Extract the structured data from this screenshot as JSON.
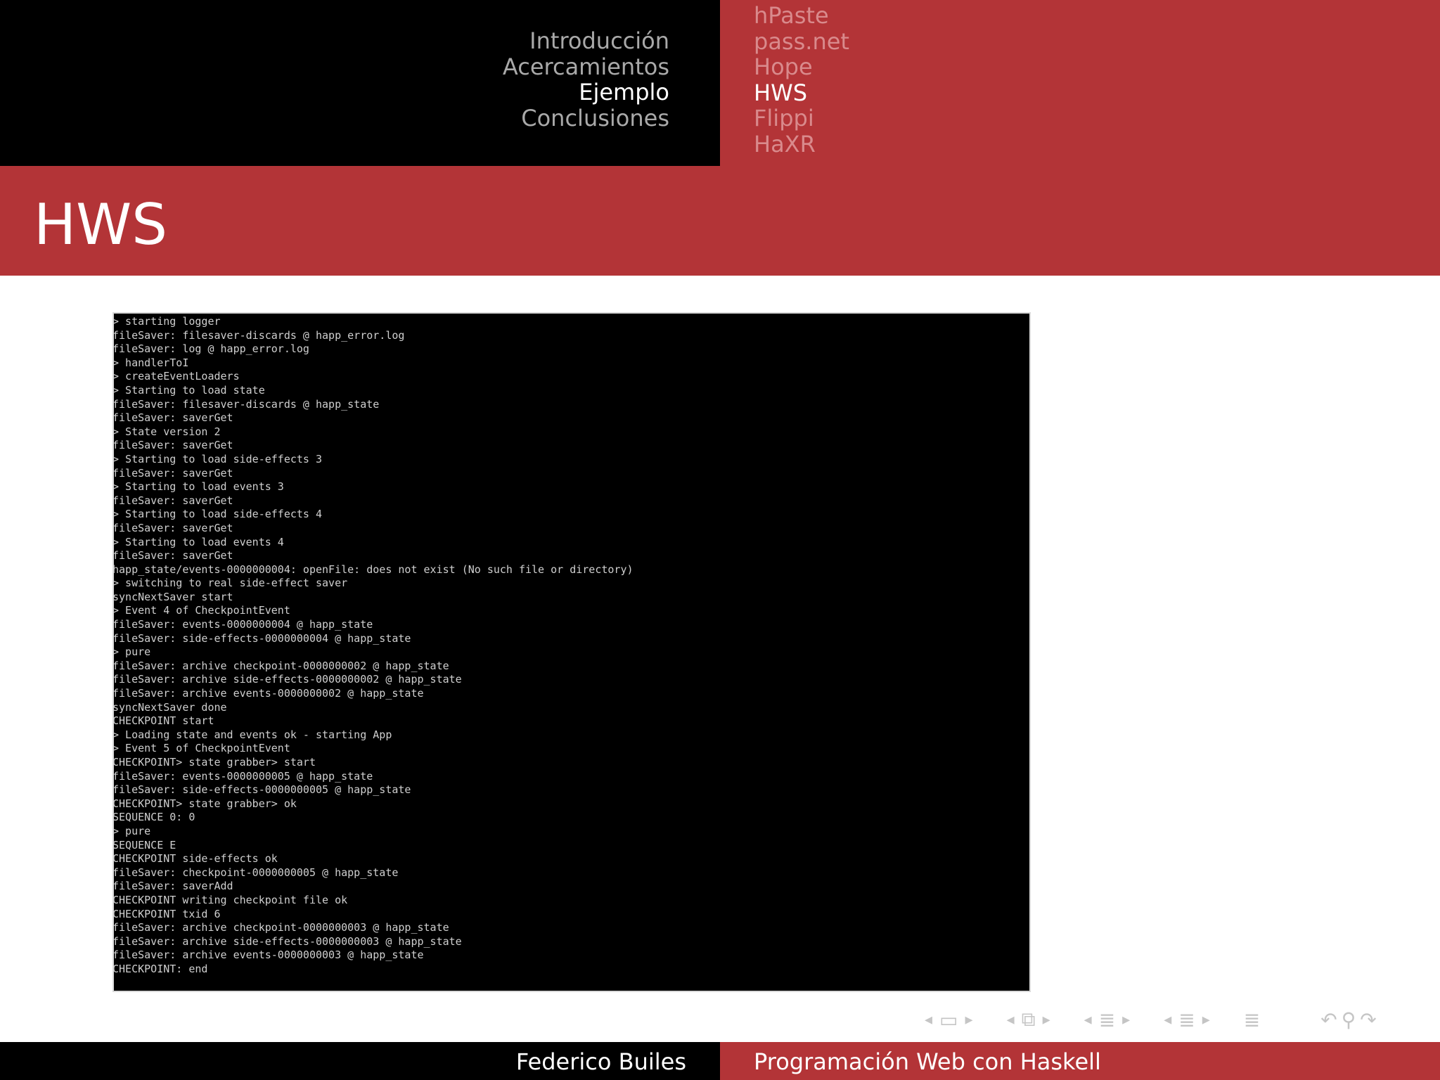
{
  "header": {
    "sections": [
      "Introducción",
      "Acercamientos",
      "Ejemplo",
      "Conclusiones"
    ],
    "subsections": [
      "hPaste",
      "pass.net",
      "Hope",
      "HWS",
      "Flippi",
      "HaXR"
    ]
  },
  "frame_title": "HWS",
  "terminal_lines": [
    "> starting logger",
    "fileSaver: filesaver-discards @ happ_error.log",
    "fileSaver: log @ happ_error.log",
    "> handlerToI",
    "> createEventLoaders",
    "> Starting to load state",
    "fileSaver: filesaver-discards @ happ_state",
    "fileSaver: saverGet",
    "> State version 2",
    "fileSaver: saverGet",
    "> Starting to load side-effects 3",
    "fileSaver: saverGet",
    "> Starting to load events 3",
    "fileSaver: saverGet",
    "> Starting to load side-effects 4",
    "fileSaver: saverGet",
    "> Starting to load events 4",
    "fileSaver: saverGet",
    "happ_state/events-0000000004: openFile: does not exist (No such file or directory)",
    "> switching to real side-effect saver",
    "syncNextSaver start",
    "> Event 4 of CheckpointEvent",
    "fileSaver: events-0000000004 @ happ_state",
    "fileSaver: side-effects-0000000004 @ happ_state",
    "> pure",
    "fileSaver: archive checkpoint-0000000002 @ happ_state",
    "fileSaver: archive side-effects-0000000002 @ happ_state",
    "fileSaver: archive events-0000000002 @ happ_state",
    "syncNextSaver done",
    "CHECKPOINT start",
    "> Loading state and events ok - starting App",
    "> Event 5 of CheckpointEvent",
    "CHECKPOINT> state grabber> start",
    "fileSaver: events-0000000005 @ happ_state",
    "fileSaver: side-effects-0000000005 @ happ_state",
    "CHECKPOINT> state grabber> ok",
    "SEQUENCE 0: 0",
    "> pure",
    "SEQUENCE E",
    "CHECKPOINT side-effects ok",
    "fileSaver: checkpoint-0000000005 @ happ_state",
    "fileSaver: saverAdd",
    "CHECKPOINT writing checkpoint file ok",
    "CHECKPOINT txid 6",
    "fileSaver: archive checkpoint-0000000003 @ happ_state",
    "fileSaver: archive side-effects-0000000003 @ happ_state",
    "fileSaver: archive events-0000000003 @ happ_state",
    "CHECKPOINT: end"
  ],
  "footer": {
    "author": "Federico Builes",
    "talk_title": "Programación Web con Haskell"
  },
  "nav_icons": [
    "slide-nav-icon",
    "frame-nav-icon",
    "subsection-nav-icon",
    "section-nav-icon",
    "appendix-nav-icon",
    "back-icon",
    "search-icon",
    "forward-icon"
  ]
}
